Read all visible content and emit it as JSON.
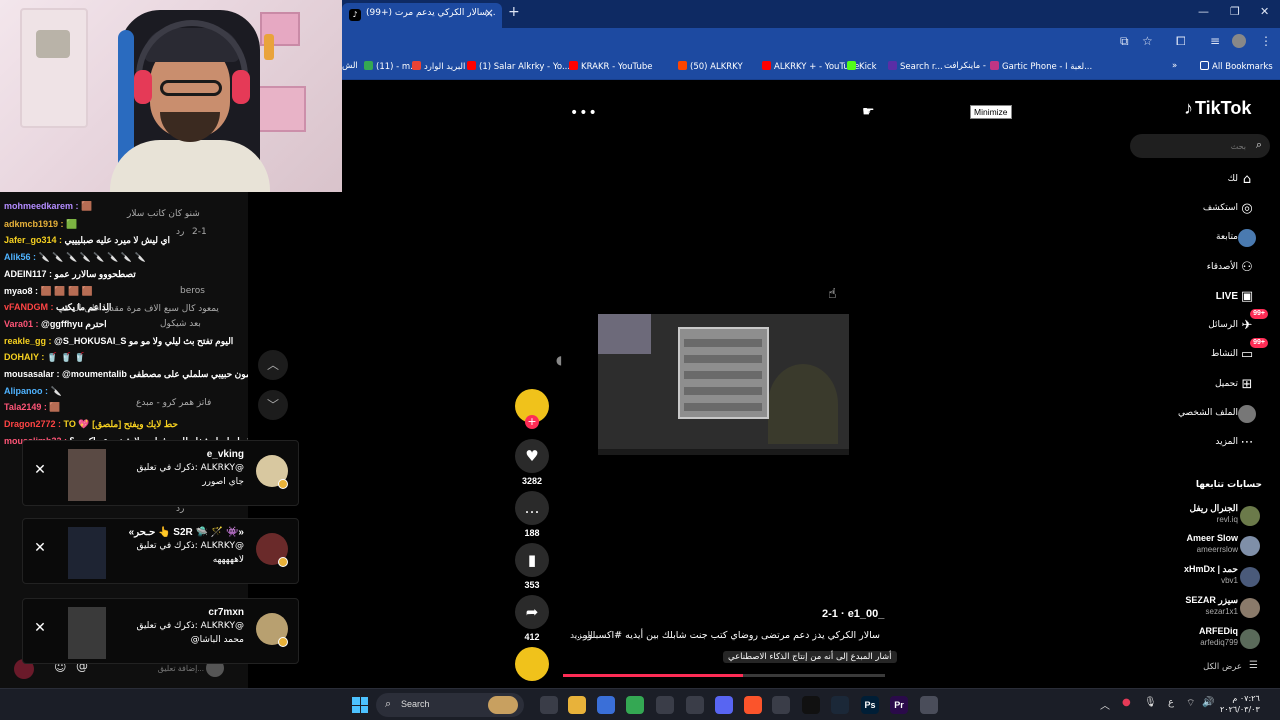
{
  "browser": {
    "tab_title": "(99+) سالار الكركي يدعم مرت...",
    "tab_icon": "tiktok-icon",
    "bookmarks": [
      {
        "label": "(11) - m...",
        "color": "#34a853"
      },
      {
        "label": "البريد الوارد",
        "color": "#ea4335"
      },
      {
        "label": "(1) Salar Alkrky - Yo...",
        "color": "#ff0000"
      },
      {
        "label": "KRAKR - YouTube",
        "color": "#ff0000"
      },
      {
        "label": "(50) ALKRKY",
        "color": "#ff4500"
      },
      {
        "label": "ALKRKY + - YouTube",
        "color": "#ff0000"
      },
      {
        "label": "Kick",
        "color": "#53fc18"
      },
      {
        "label": "Search r...",
        "color": "#5a2ea6"
      },
      {
        "label": "ماينكرافت -",
        "color": "#3b6fd8"
      },
      {
        "label": "Gartic Phone - لعبة ا...",
        "color": "#c13584"
      }
    ],
    "bookmarks_leading": "الش",
    "all_bookmarks": "All Bookmarks"
  },
  "tiktok": {
    "logo": "TikTok",
    "search_placeholder": "بحث",
    "tooltip": "Minimize",
    "nav": [
      {
        "label": "لك",
        "icon": "home-icon"
      },
      {
        "label": "استكشف",
        "icon": "compass-icon"
      },
      {
        "label": "متابعة",
        "icon": "following-avatar"
      },
      {
        "label": "الأصدقاء",
        "icon": "friends-icon"
      },
      {
        "label": "LIVE",
        "icon": "live-icon"
      },
      {
        "label": "الرسائل",
        "icon": "messages-icon",
        "badge": "99+"
      },
      {
        "label": "النشاط",
        "icon": "activity-icon",
        "badge": "99+"
      },
      {
        "label": "تحميل",
        "icon": "upload-icon"
      },
      {
        "label": "الملف الشخصي",
        "icon": "profile-avatar"
      },
      {
        "label": "المزيد",
        "icon": "more-icon"
      }
    ],
    "following_title": "حسابات تتابعها",
    "following": [
      {
        "name": "الجنرال ريفل",
        "user": "revl.iq",
        "color": "#6b7a4a"
      },
      {
        "name": "Ameer Slow",
        "user": "ameerrslow",
        "color": "#7f8fa8"
      },
      {
        "name": "xHmDx | حمد",
        "user": "vbv1",
        "color": "#4a5a7a"
      },
      {
        "name": "SEZAR سيزر",
        "user": "sezar1x1",
        "color": "#8a7a6a"
      },
      {
        "name": "ARFEDiq",
        "user": "arfediq799",
        "color": "#5a6a5a"
      }
    ],
    "show_all": "عرض الكل",
    "video": {
      "author": "e1_00_",
      "date": "2-1",
      "caption": "سالار الكركي يدز دعم مرتضى روضاي كتب جنت شابلك بين أيديه #اكسبلور...",
      "more": "المزيد",
      "ai_label": "أشار المبدع إلى أنه من إنتاج الذكاء الاصطناعي",
      "likes": "3282",
      "comments": "188",
      "saves": "353",
      "shares": "412",
      "progress": 0.56
    }
  },
  "chat": {
    "lines": [
      {
        "user": "mohmeedkarem :",
        "color": "#b38cff",
        "msg": "🟫"
      },
      {
        "user": "adkmcb1919 :",
        "color": "#e8b23a",
        "msg": "🟩"
      },
      {
        "user": "Jafer_go314 :",
        "color": "#f5d020",
        "msg": "اي ليش لا ميرد عليه صبليييي"
      },
      {
        "user": "Alik56 :",
        "color": "#4fb3ff",
        "msg": "🔪 🔪 🔪 🔪 🔪 🔪 🔪 🔪"
      },
      {
        "user": "ADEIN117 :",
        "color": "#fff",
        "msg": "تصطحووو سالارر عمو"
      },
      {
        "user": "myao8 :",
        "color": "#fff",
        "msg": "🟫 🟫 🟫 🟫"
      },
      {
        "user": "vFANDGM :",
        "color": "#ff4444",
        "msg": "الداعم ما يكتب"
      },
      {
        "user": "Vara01 :",
        "color": "#ff5577",
        "msg": "@ggffhyu احترم"
      },
      {
        "user": "reakle_gg :",
        "color": "#f5d020",
        "msg": "@S_HOKUSAI_S اليوم تفتح بث ليلي ولا مو مو"
      },
      {
        "user": "DOHAIY :",
        "color": "#f5d020",
        "msg": "🥤 🥤 🥤"
      },
      {
        "user": "mousasalar :",
        "color": "#fff",
        "msg": "@moumentalib شلونك ابو المون حبيبي سلملي على مصطفى"
      },
      {
        "user": "Alipanoo :",
        "color": "#4fb3ff",
        "msg": "🔪"
      },
      {
        "user": "Tala2149 :",
        "color": "#ff5577",
        "msg": "🟫"
      },
      {
        "user": "Dragon2772 :",
        "color": "#ff4444",
        "msg": "TO 💖 [ملصق] حط لايك ويفتح"
      },
      {
        "user": "mousslimb32 :",
        "color": "#ff5577",
        "msg": "شو قصة سالار مع ***** ماصاروا يشغله للسيرفرات ولا شخصية ماكرى ؟"
      }
    ],
    "bg_comments": [
      {
        "text": "شنو كان كاتب سلار"
      },
      {
        "text": "رد"
      },
      {
        "text": "2-1"
      },
      {
        "text": "beros"
      },
      {
        "text": "يمعود كال سبع الاف مرة مقدرا على الدعم"
      },
      {
        "text": "بعد شيكول"
      },
      {
        "text": "فاتز همر كرو - مبدع"
      },
      {
        "text": "رد"
      }
    ],
    "notifications": [
      {
        "name": "e_vking",
        "line2": "ذكرك في تعليق: ALKRKY@",
        "line3": "جاي اصورر"
      },
      {
        "name": "«حـحر 👆 S2R 🛸 🪄 👾»",
        "line2": "ذكرك في تعليق: ALKRKY@",
        "line3": "لاهههههه"
      },
      {
        "name": "cr7mxn",
        "line2": "ذكرك في تعليق: ALKRKY@",
        "line3": "@محمد الباشا"
      }
    ],
    "input_placeholder": "إضافة تعليق..."
  },
  "taskbar": {
    "search": "Search",
    "apps": [
      {
        "name": "task-view-icon",
        "color": "#3a3d48",
        "label": ""
      },
      {
        "name": "file-explorer-icon",
        "color": "#e8b23a",
        "label": ""
      },
      {
        "name": "store-icon",
        "color": "#3a6fd8",
        "label": ""
      },
      {
        "name": "chrome-icon",
        "color": "#34a853",
        "label": ""
      },
      {
        "name": "obs-icon",
        "color": "#3a3d48",
        "label": ""
      },
      {
        "name": "settings-icon",
        "color": "#3a3d48",
        "label": ""
      },
      {
        "name": "discord-icon",
        "color": "#5865f2",
        "label": ""
      },
      {
        "name": "brave-icon",
        "color": "#fb542b",
        "label": ""
      },
      {
        "name": "notes-icon",
        "color": "#3a3d48",
        "label": ""
      },
      {
        "name": "capcut-icon",
        "color": "#111",
        "label": ""
      },
      {
        "name": "steam-icon",
        "color": "#1b2838",
        "label": ""
      },
      {
        "name": "photoshop-icon",
        "color": "#001e36",
        "label": "Ps"
      },
      {
        "name": "premiere-icon",
        "color": "#2a0a4a",
        "label": "Pr"
      },
      {
        "name": "app-icon",
        "color": "#4a4d5a",
        "label": ""
      }
    ],
    "lang": "ع",
    "time": "٠٧:٢٦ م",
    "date": "٢٠٢٦/٠٣/٠٣"
  }
}
